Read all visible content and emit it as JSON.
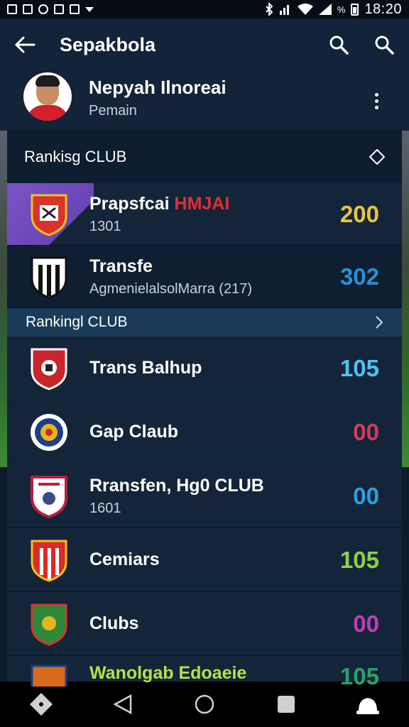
{
  "status_bar": {
    "time": "18:20",
    "signal_text": "%"
  },
  "app_bar": {
    "title": "Sepakbola"
  },
  "profile": {
    "name": "Nepyah Ilnoreai",
    "subtitle": "Pemain"
  },
  "sections": [
    {
      "title": "Rankisg CLUB"
    },
    {
      "title": "Rankingl CLUB"
    }
  ],
  "clubs_top": [
    {
      "name": "Prapsfcai",
      "name_accent": "HMJAI",
      "sub": "1301",
      "value": "200",
      "value_color": "#e8c540",
      "crest_color": "#d9342b"
    },
    {
      "name": "Transfe",
      "name_accent": "",
      "sub": "AgmenielalsolMarra (217)",
      "value": "302",
      "value_color": "#2c8fd1",
      "crest_color": "#ffffff"
    }
  ],
  "clubs_bottom": [
    {
      "name": "Trans Balhup",
      "sub": "",
      "value": "105",
      "value_color": "#4fc3f0",
      "crest_color": "#c9252c"
    },
    {
      "name": "Gap Claub",
      "sub": "",
      "value": "00",
      "value_color": "#d23a5e",
      "crest_color": "#1b3f8a"
    },
    {
      "name": "Rransfen, Hg0 CLUB",
      "sub": "1601",
      "value": "00",
      "value_color": "#2f9fe0",
      "crest_color": "#b5203e"
    },
    {
      "name": "Cemiars",
      "sub": "",
      "value": "105",
      "value_color": "#8ed04a",
      "crest_color": "#d92b2b"
    },
    {
      "name": "Clubs",
      "sub": "",
      "value": "00",
      "value_color": "#c13cb8",
      "crest_color": "#2e8a3a"
    },
    {
      "name": "Wanolgab Edoaeie",
      "sub": "",
      "value": "105",
      "value_color": "#2ba06a",
      "crest_color": "#d96a1c"
    }
  ]
}
